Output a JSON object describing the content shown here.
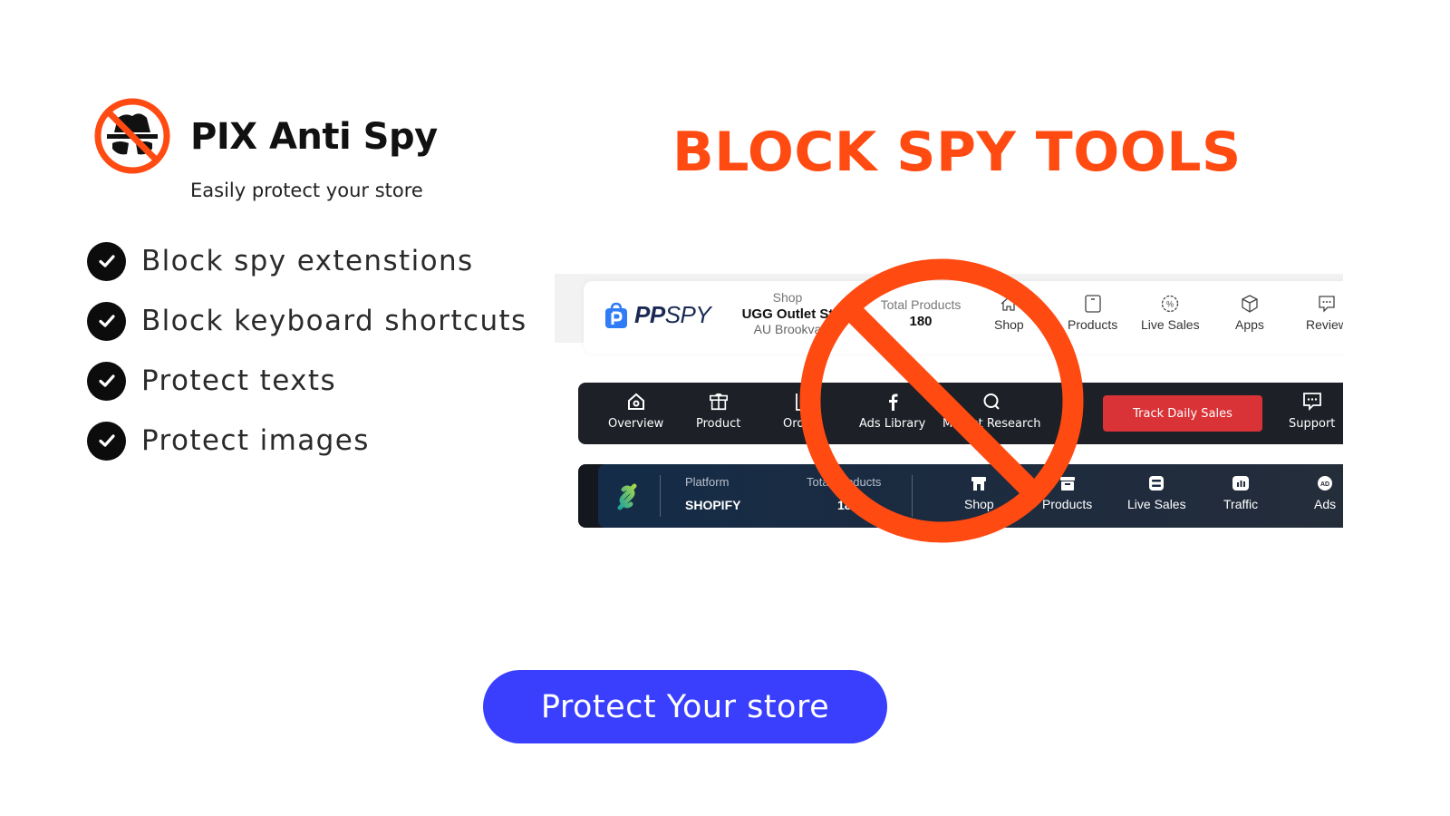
{
  "brand": {
    "name": "PIX Anti Spy",
    "tagline": "Easily protect your store",
    "logo_icon": "spy-prohibited-icon"
  },
  "features": [
    {
      "label": "Block spy extenstions",
      "icon": "check-circle-icon"
    },
    {
      "label": "Block keyboard shortcuts",
      "icon": "check-circle-icon"
    },
    {
      "label": "Protect texts",
      "icon": "check-circle-icon"
    },
    {
      "label": "Protect images",
      "icon": "check-circle-icon"
    }
  ],
  "headline": "BLOCK SPY TOOLS",
  "cta": {
    "label": "Protect Your store"
  },
  "colors": {
    "accent_orange": "#ff4a12",
    "cta_blue": "#3a3ffd",
    "track_red": "#d93237",
    "dark_bar": "#1e2027",
    "navy_bar": "#1b2b40"
  },
  "spy_tools": {
    "ppspy": {
      "logo_bold": "PP",
      "logo_light": "SPY",
      "shop_label": "Shop",
      "shop_name": "UGG Outlet St",
      "shop_location": "AU Brookva",
      "total_label": "Total Products",
      "total_value": "180",
      "nav": [
        {
          "label": "Shop",
          "icon": "home-icon"
        },
        {
          "label": "Products",
          "icon": "box-icon"
        },
        {
          "label": "Live Sales",
          "icon": "percent-badge-icon"
        },
        {
          "label": "Apps",
          "icon": "cube-icon"
        },
        {
          "label": "Review",
          "icon": "chat-icon"
        }
      ]
    },
    "dark_tool": {
      "nav": [
        {
          "label": "Overview",
          "icon": "home-icon"
        },
        {
          "label": "Product",
          "icon": "package-icon"
        },
        {
          "label": "Orders",
          "icon": "orders-icon"
        },
        {
          "label": "Ads Library",
          "icon": "facebook-icon"
        },
        {
          "label": "Market Research",
          "icon": "search-icon"
        }
      ],
      "track_button": "Track Daily Sales",
      "support": {
        "label": "Support",
        "icon": "chat-icon"
      }
    },
    "navy_tool": {
      "platform_label": "Platform",
      "platform_value": "SHOPIFY",
      "total_label": "Total Products",
      "total_value": "180",
      "nav": [
        {
          "label": "Shop",
          "icon": "store-icon"
        },
        {
          "label": "Products",
          "icon": "archive-icon"
        },
        {
          "label": "Live Sales",
          "icon": "live-icon"
        },
        {
          "label": "Traffic",
          "icon": "chart-icon"
        },
        {
          "label": "Ads",
          "icon": "ad-icon"
        }
      ]
    }
  },
  "overlay": {
    "icon": "prohibited-icon"
  }
}
